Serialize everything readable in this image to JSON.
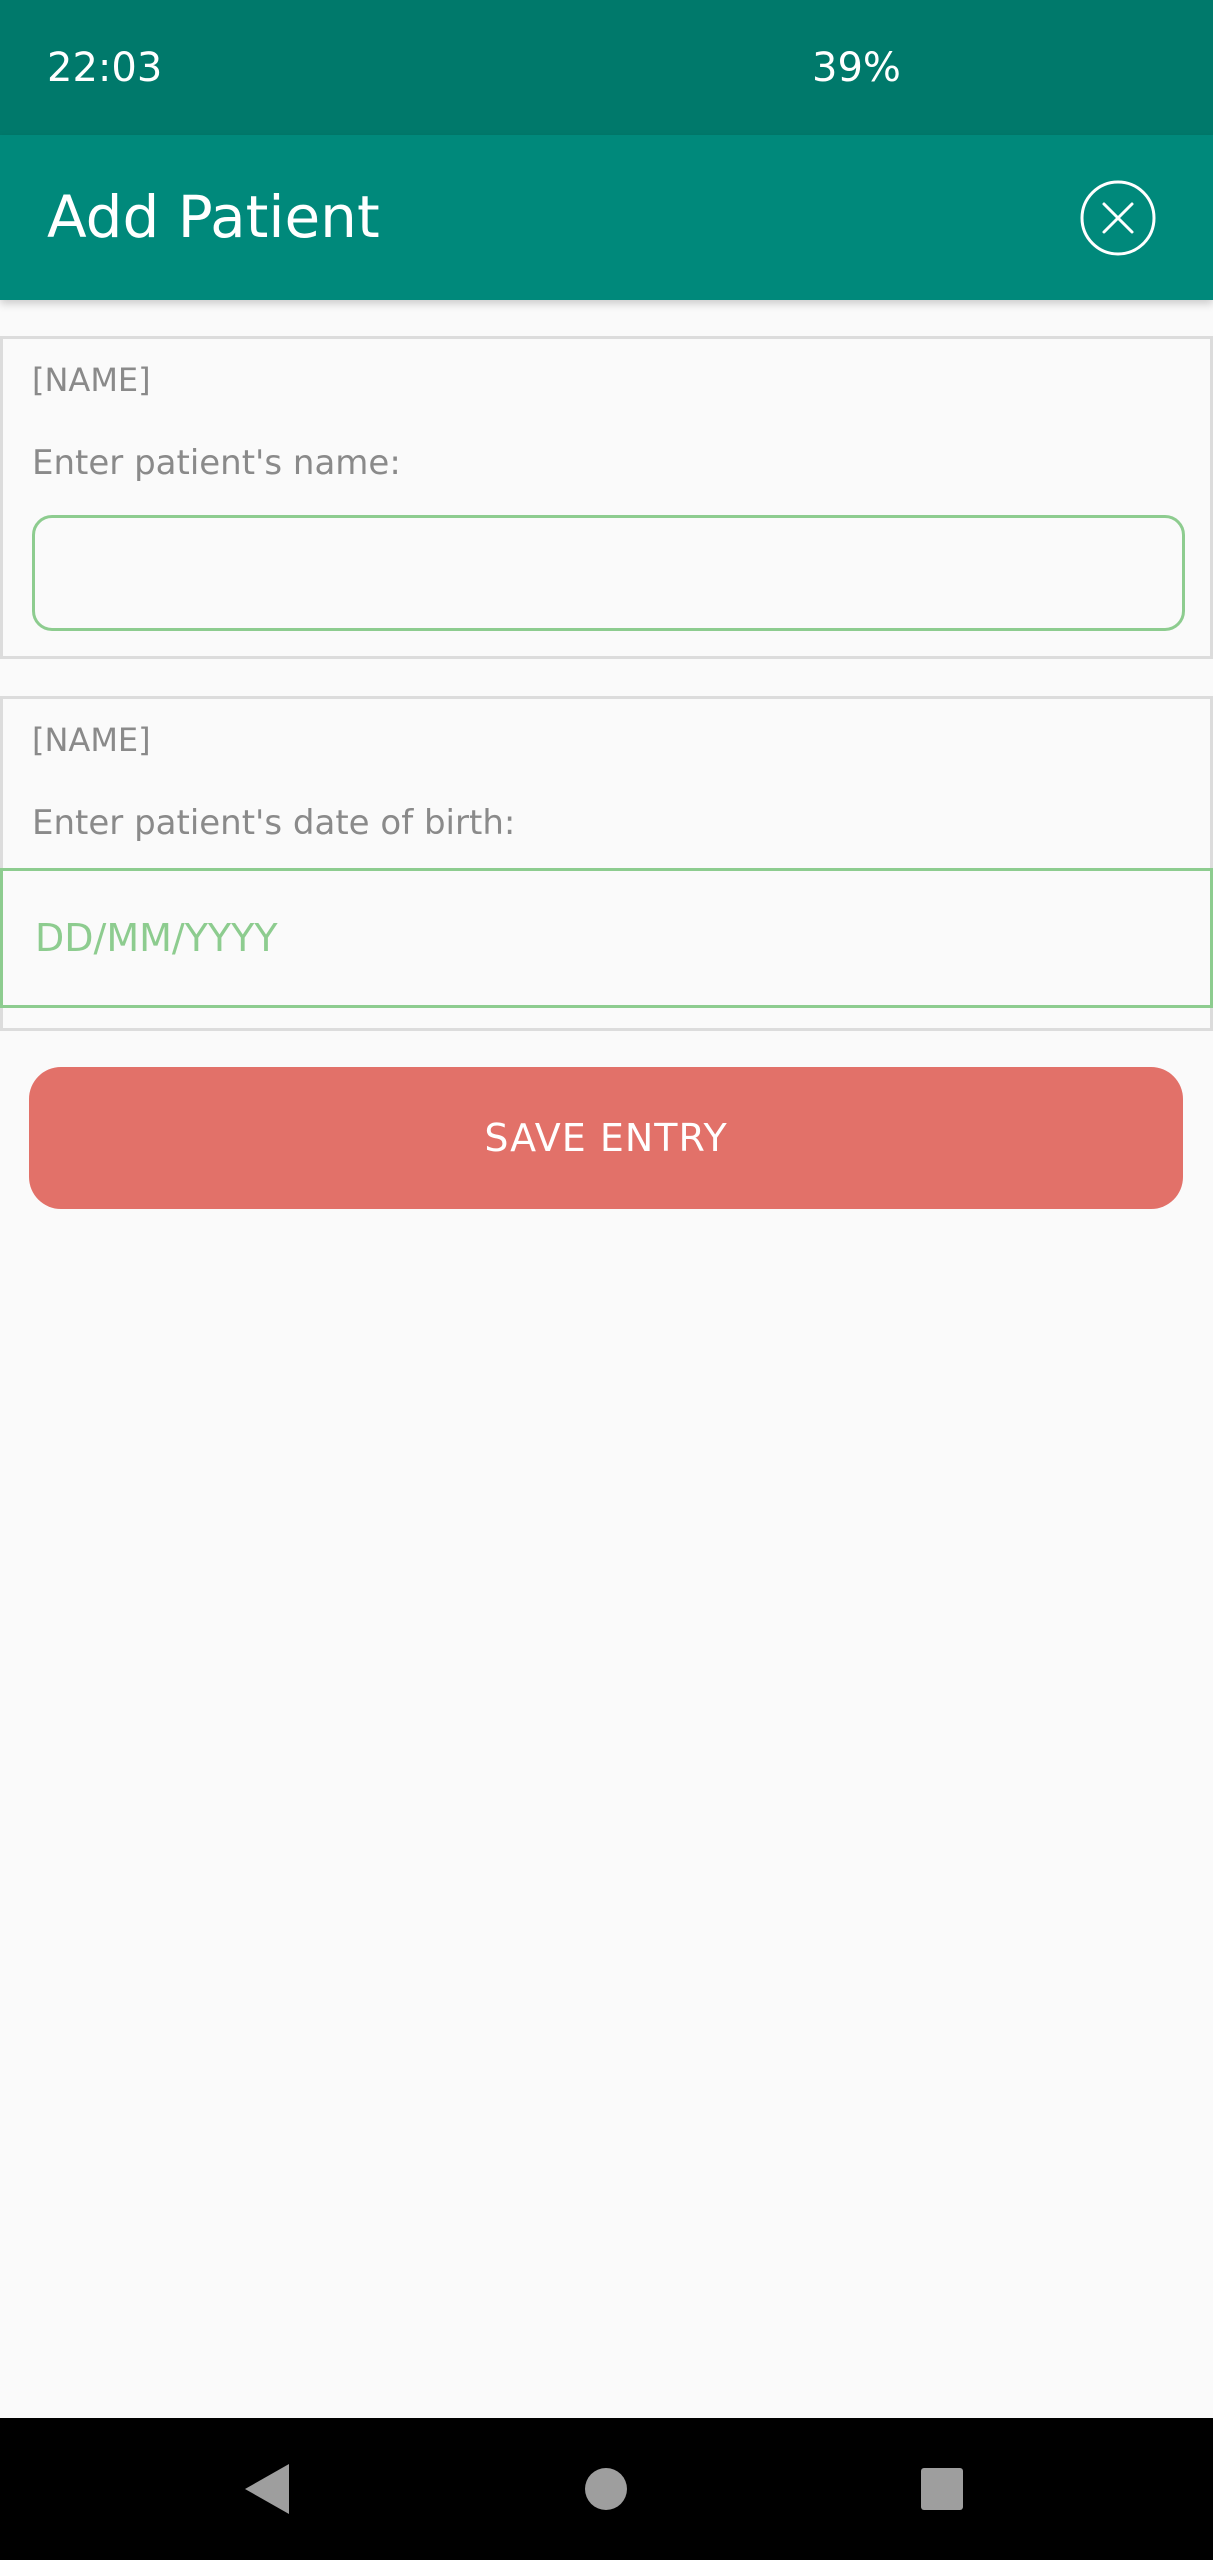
{
  "status_bar": {
    "time": "22:03",
    "battery": "39%"
  },
  "app_bar": {
    "title": "Add Patient",
    "close_icon": "close-circle-icon"
  },
  "form": {
    "name_card": {
      "tag": "[NAME]",
      "prompt": "Enter patient's name:",
      "value": "",
      "placeholder": ""
    },
    "dob_card": {
      "tag": "[NAME]",
      "prompt": "Enter patient's date of birth:",
      "value": "",
      "placeholder": "DD/MM/YYYY"
    },
    "save_label": "SAVE ENTRY"
  },
  "nav_bar": {
    "back_icon": "back-triangle-icon",
    "home_icon": "home-circle-icon",
    "recents_icon": "recents-square-icon"
  },
  "colors": {
    "status_bar": "#00796b",
    "app_bar": "#00897b",
    "input_border": "#8dcc8f",
    "save_button": "#e27169",
    "background": "#fafafa"
  }
}
